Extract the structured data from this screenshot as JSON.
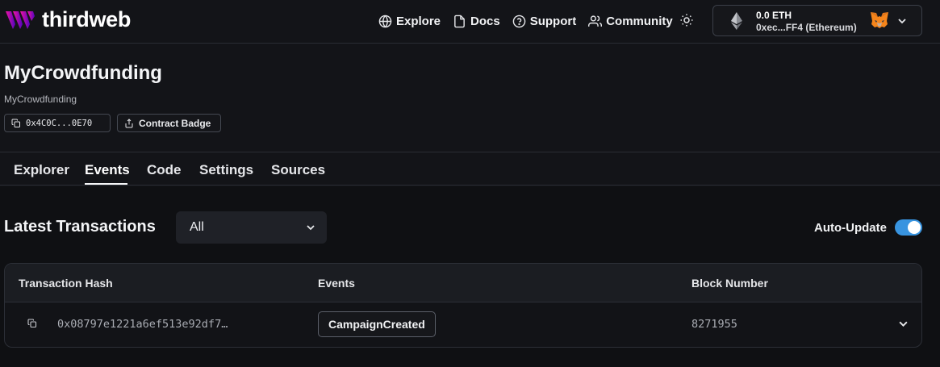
{
  "brand": {
    "name": "thirdweb"
  },
  "nav": {
    "links": [
      {
        "label": "Explore",
        "icon": "globe-icon"
      },
      {
        "label": "Docs",
        "icon": "document-icon"
      },
      {
        "label": "Support",
        "icon": "help-circle-icon"
      },
      {
        "label": "Community",
        "icon": "users-icon"
      }
    ],
    "theme_icon": "sun-icon"
  },
  "wallet": {
    "balance": "0.0 ETH",
    "address": "0xec...FF4 (Ethereum)",
    "network_icon": "ethereum-icon",
    "provider_icon": "metamask-fox-icon"
  },
  "contract": {
    "title": "MyCrowdfunding",
    "subtitle": "MyCrowdfunding",
    "address_short": "0x4C0C...0E70",
    "badge_label": "Contract Badge"
  },
  "tabs": [
    {
      "label": "Explorer",
      "active": false
    },
    {
      "label": "Events",
      "active": true
    },
    {
      "label": "Code",
      "active": false
    },
    {
      "label": "Settings",
      "active": false
    },
    {
      "label": "Sources",
      "active": false
    }
  ],
  "transactions": {
    "title": "Latest Transactions",
    "filter_value": "All",
    "auto_update_label": "Auto-Update",
    "auto_update_on": true,
    "columns": [
      "Transaction Hash",
      "Events",
      "Block Number"
    ],
    "rows": [
      {
        "hash": "0x08797e1221a6ef513e92df7…",
        "event": "CampaignCreated",
        "block": "8271955"
      }
    ]
  },
  "colors": {
    "background": "#131418",
    "toggle_on": "#3894e0",
    "brand_gradient_start": "#f213a4",
    "brand_gradient_end": "#5204bf"
  }
}
